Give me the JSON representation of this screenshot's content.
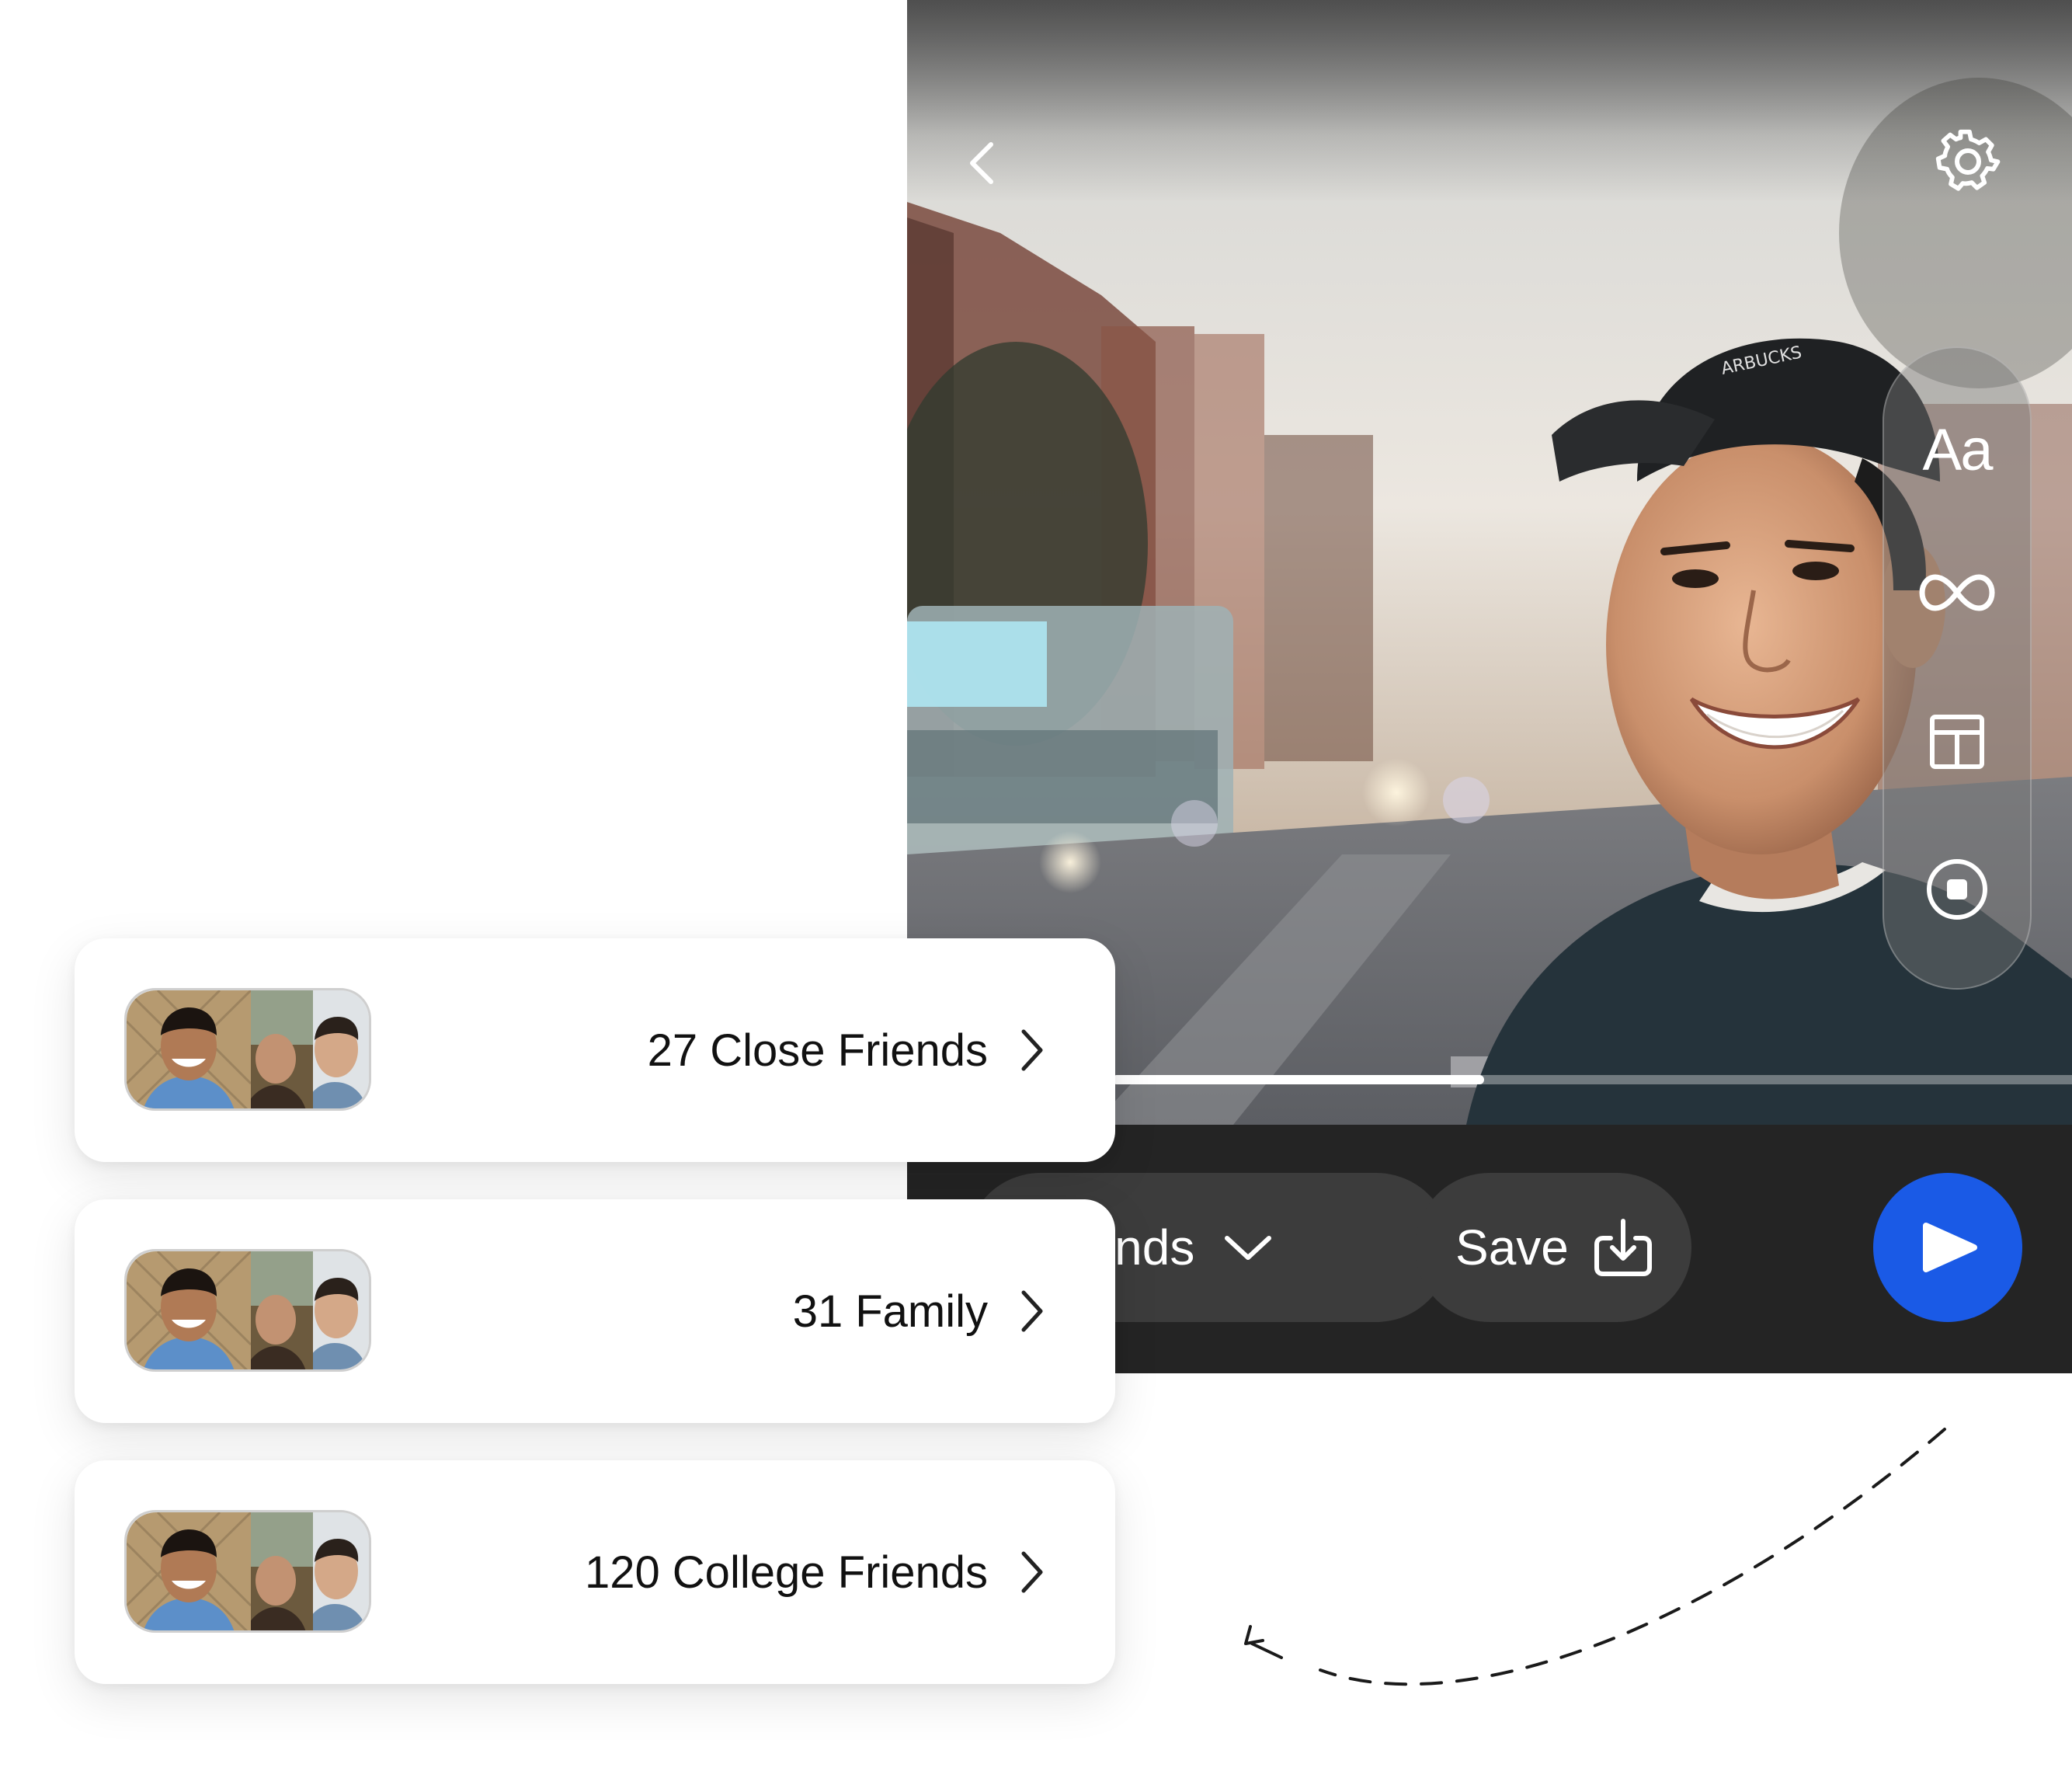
{
  "camera": {
    "back_icon": "chevron-left-icon",
    "settings_icon": "gear-icon",
    "tools": [
      {
        "name": "text",
        "glyph": "Aa",
        "icon": "text-style-icon"
      },
      {
        "name": "loop",
        "icon": "infinity-icon"
      },
      {
        "name": "layout",
        "icon": "layout-icon"
      },
      {
        "name": "stop",
        "icon": "stop-record-icon"
      }
    ],
    "progress": 0.36
  },
  "bottom_bar": {
    "audience_label": "riends",
    "audience_icon": "chevron-down-icon",
    "save_label": "Save",
    "save_icon": "download-icon",
    "send_icon": "play-send-icon",
    "send_color": "#1a5ae6"
  },
  "groups": [
    {
      "count": "27",
      "name": "Close Friends"
    },
    {
      "count": "31",
      "name": "Family"
    },
    {
      "count": "120",
      "name": "College Friends"
    }
  ],
  "colors": {
    "bar_background": "#242424",
    "pill_background": "#3c3c3c",
    "send_accent": "#1a5ae6"
  }
}
